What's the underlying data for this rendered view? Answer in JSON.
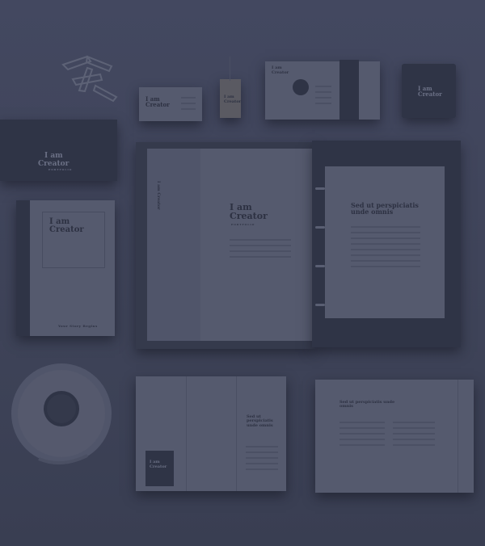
{
  "brand": {
    "line1": "I am",
    "line2": "Creator",
    "tagline": "PORTFOLIO",
    "line_full": "I am Creator"
  },
  "headline": {
    "binder": "Sed ut perspiciatis unde omnis",
    "brochure_left": "Sed ut perspiciatis unde omnis",
    "brochure_right": "Sed ut perspiciatis unde omnis"
  },
  "notebook_footer": "Your Story Begins"
}
